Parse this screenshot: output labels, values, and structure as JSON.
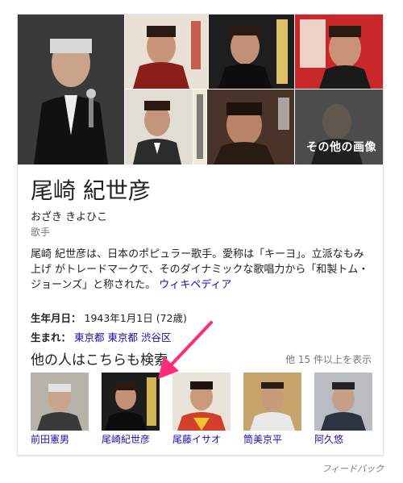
{
  "entity": {
    "name": "尾崎 紀世彦",
    "reading": "おざき きよひこ",
    "category": "歌手",
    "description": "尾崎 紀世彦は、日本のポピュラー歌手。愛称は「キーヨ」。立派なもみ上げ がトレードマークで、そのダイナミックな歌唱力から「和製トム・ジョーンズ」と称された。",
    "source_link": "ウィキペディア"
  },
  "gallery": {
    "more_images_label": "その他の画像"
  },
  "facts": [
    {
      "key": "生年月日：",
      "value": "1943年1月1日 (72歳)"
    },
    {
      "key": "生まれ：",
      "links": [
        "東京都",
        "東京都",
        "渋谷区"
      ]
    }
  ],
  "related": {
    "title": "他の人はこちらも検索",
    "see_more": "他 15 件以上を表示",
    "people": [
      {
        "name": "前田憲男"
      },
      {
        "name": "尾崎紀世彦"
      },
      {
        "name": "尾藤イサオ"
      },
      {
        "name": "筒美京平"
      },
      {
        "name": "阿久悠"
      }
    ]
  },
  "feedback": "フィードバック",
  "colors": {
    "link": "#1a0dab",
    "annotation_arrow": "#ff2d78"
  }
}
